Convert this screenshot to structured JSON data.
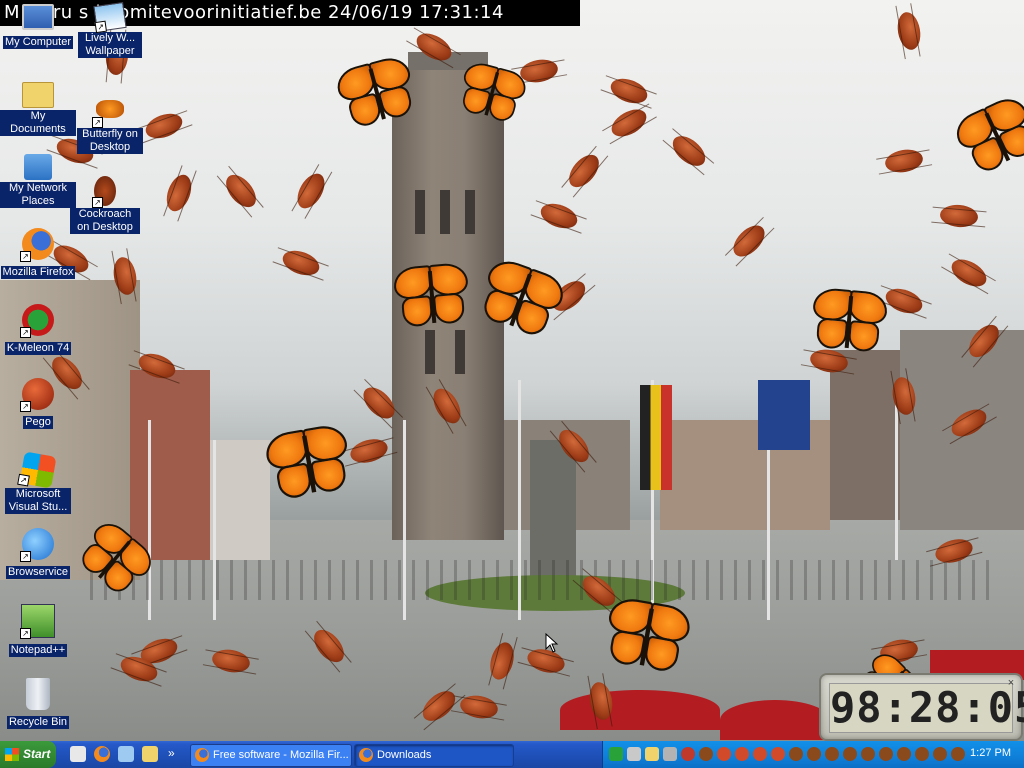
{
  "caption": "M  t Bru  s | comitevoorinitiatief.be 24/06/19 17:31:14",
  "desktop_icons": [
    {
      "label": "My Computer",
      "icon": "computer-icon"
    },
    {
      "label": "My Documents",
      "icon": "folder-icon"
    },
    {
      "label": "My Network Places",
      "icon": "network-icon"
    },
    {
      "label": "Mozilla Firefox",
      "icon": "firefox-icon"
    },
    {
      "label": "K-Meleon 74",
      "icon": "kmeleon-icon"
    },
    {
      "label": "Pego",
      "icon": "pego-icon"
    },
    {
      "label": "Microsoft Visual Stu...",
      "icon": "visual-studio-icon"
    },
    {
      "label": "Browservice",
      "icon": "browser-icon"
    },
    {
      "label": "Notepad++",
      "icon": "notepad-icon"
    },
    {
      "label": "Recycle Bin",
      "icon": "recycle-bin-icon"
    },
    {
      "label": "Lively W... Wallpaper",
      "icon": "wallpaper-icon"
    },
    {
      "label": "Butterfly on Desktop",
      "icon": "butterfly-icon"
    },
    {
      "label": "Cockroach on Desktop",
      "icon": "cockroach-icon"
    }
  ],
  "clock_widget": {
    "time": "98:28:05"
  },
  "taskbar": {
    "start_label": "Start",
    "tasks": [
      {
        "label": "Free software - Mozilla Fir...",
        "active": false
      },
      {
        "label": "Downloads",
        "active": true
      }
    ],
    "tray_time": "1:27 PM"
  },
  "colors": {
    "taskbar": "#245edb",
    "start": "#3b9a3b",
    "icon_label_bg": "#0a246a"
  }
}
